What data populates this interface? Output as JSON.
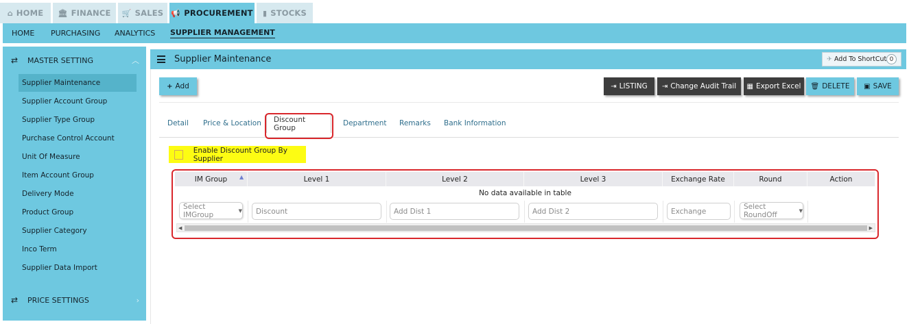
{
  "top_tabs": [
    {
      "label": "HOME",
      "icon": "home-icon"
    },
    {
      "label": "FINANCE",
      "icon": "bank-icon"
    },
    {
      "label": "SALES",
      "icon": "cart-icon"
    },
    {
      "label": "PROCUREMENT",
      "icon": "megaphone-icon",
      "active": true
    },
    {
      "label": "STOCKS",
      "icon": "bar-chart-icon"
    }
  ],
  "sub_nav": [
    {
      "label": "HOME"
    },
    {
      "label": "PURCHASING"
    },
    {
      "label": "ANALYTICS"
    },
    {
      "label": "SUPPLIER MANAGEMENT",
      "active": true
    }
  ],
  "sidebar": {
    "master_setting": "MASTER SETTING",
    "price_settings": "PRICE SETTINGS",
    "items": [
      {
        "label": "Supplier Maintenance",
        "active": true
      },
      {
        "label": "Supplier Account Group"
      },
      {
        "label": "Supplier Type Group"
      },
      {
        "label": "Purchase Control Account"
      },
      {
        "label": "Unit Of Measure"
      },
      {
        "label": "Item Account Group"
      },
      {
        "label": "Delivery Mode"
      },
      {
        "label": "Product Group"
      },
      {
        "label": "Supplier Category"
      },
      {
        "label": "Inco Term"
      },
      {
        "label": "Supplier Data Import"
      }
    ]
  },
  "panel": {
    "title": "Supplier Maintenance",
    "shortcut_label": "Add To ShortCut",
    "shortcut_count": "0"
  },
  "toolbar": {
    "add": "Add",
    "listing": "LISTING",
    "audit": "Change Audit Trail",
    "export": "Export Excel",
    "delete": "DELETE",
    "save": "SAVE"
  },
  "tabs": [
    {
      "label": "Detail"
    },
    {
      "label": "Price & Location"
    },
    {
      "label": "Discount Group",
      "active": true
    },
    {
      "label": "Department"
    },
    {
      "label": "Remarks"
    },
    {
      "label": "Bank Information"
    }
  ],
  "enable_label": "Enable Discount Group By Supplier",
  "table": {
    "columns": [
      "IM Group",
      "Level 1",
      "Level 2",
      "Level 3",
      "Exchange Rate",
      "Round",
      "Action"
    ],
    "empty_text": "No data available in table",
    "filters": {
      "im_group": "Select IMGroup",
      "discount": "Discount",
      "dist1": "Add Dist 1",
      "dist2": "Add Dist 2",
      "exchange": "Exchange",
      "round": "Select RoundOff"
    }
  },
  "colors": {
    "accent": "#6ec8e0",
    "dark_button": "#3d3d3d",
    "highlight_red": "#d9262b",
    "highlight_yellow": "#fdfc13"
  }
}
